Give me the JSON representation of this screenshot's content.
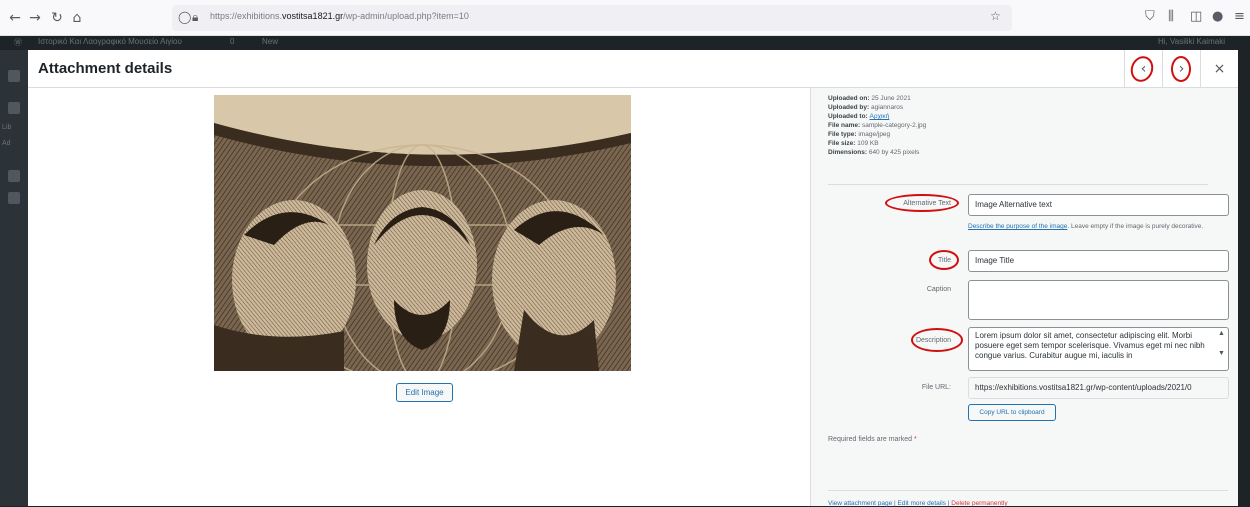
{
  "browser": {
    "url_prefix": "https://exhibitions.",
    "url_host": "vostitsa1821.gr",
    "url_path": "/wp-admin/upload.php?item=10"
  },
  "admin_bar": {
    "site_name": "Ιστορικό Και Λαογραφικό Μουσείο Αιγίου",
    "comments": "0",
    "new": "New",
    "greeting": "Hi, Vasiliki Kaimaki"
  },
  "admin_menu": {
    "items": [
      "Lib",
      "Ad"
    ]
  },
  "modal": {
    "title": "Attachment details",
    "prev_icon": "chevron-left-icon",
    "next_icon": "chevron-right-icon",
    "close_icon": "close-icon",
    "edit_image_label": "Edit Image"
  },
  "details": {
    "uploaded_on_label": "Uploaded on:",
    "uploaded_on": "25 June 2021",
    "uploaded_by_label": "Uploaded by:",
    "uploaded_by": "agiannaros",
    "uploaded_to_label": "Uploaded to:",
    "uploaded_to": "Αρχική",
    "file_name_label": "File name:",
    "file_name": "sample-category-2.jpg",
    "file_type_label": "File type:",
    "file_type": "image/jpeg",
    "file_size_label": "File size:",
    "file_size": "109 KB",
    "dimensions_label": "Dimensions:",
    "dimensions": "640 by 425 pixels"
  },
  "fields": {
    "alt_label": "Alternative Text",
    "alt_value": "Image Alternative text",
    "alt_help_link": "Describe the purpose of the image",
    "alt_help_rest": ". Leave empty if the image is purely decorative.",
    "title_label": "Title",
    "title_value": "Image Title",
    "caption_label": "Caption",
    "caption_value": "",
    "description_label": "Description",
    "description_value": "Lorem ipsum dolor sit amet, consectetur adipiscing elit. Morbi posuere eget sem tempor scelerisque. Vivamus eget mi nec nibh congue varius. Curabitur augue mi, iaculis in",
    "file_url_label": "File URL:",
    "file_url_value": "https://exhibitions.vostitsa1821.gr/wp-content/uploads/2021/0",
    "copy_url_label": "Copy URL to clipboard",
    "required_text": "Required fields are marked",
    "required_star": "*"
  },
  "footer_links": {
    "view": "View attachment page",
    "edit": "Edit more details",
    "delete": "Delete permanently",
    "sep": " | "
  },
  "colors": {
    "annotation_red": "#d10f0f",
    "link_blue": "#2271b1",
    "delete_red": "#d63638"
  }
}
